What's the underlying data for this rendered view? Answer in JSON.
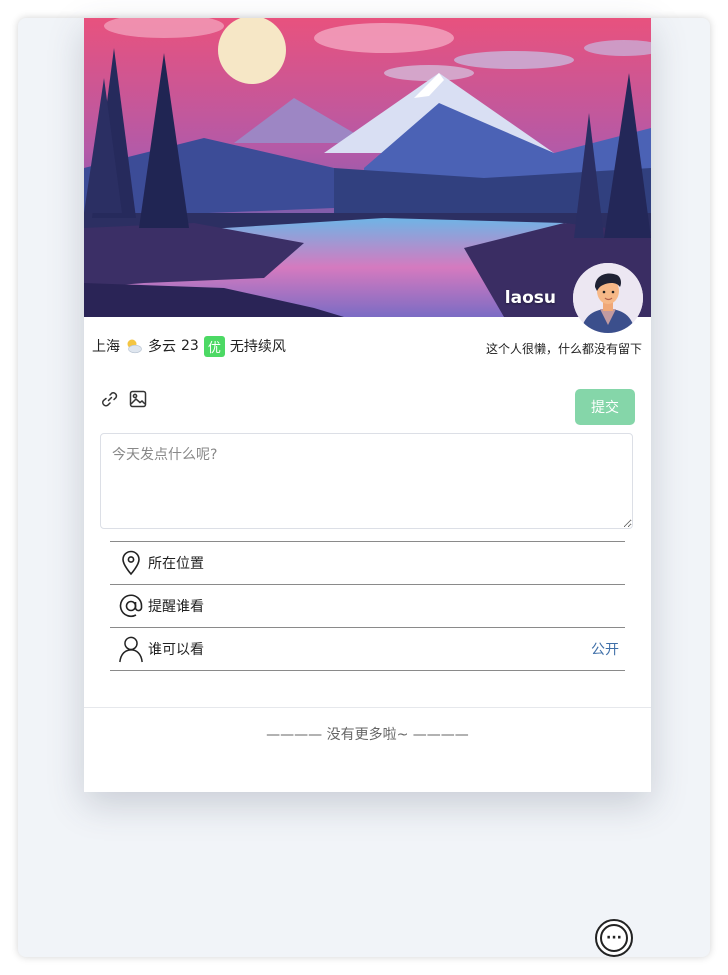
{
  "profile": {
    "username": "laosu",
    "signature": "这个人很懒，什么都没有留下",
    "cover_image": "mountain-lake-sunset-illustration",
    "avatar_image": "cartoon-man-avatar"
  },
  "weather": {
    "city": "上海",
    "icon": "partly-cloudy-icon",
    "condition": "多云",
    "temperature": "23",
    "aqi_label": "优",
    "wind": "无持续风",
    "aqi_color": "#4cd964"
  },
  "composer": {
    "link_icon": "link-icon",
    "image_icon": "image-icon",
    "submit_label": "提交",
    "submit_color": "#85d6a9",
    "placeholder": "今天发点什么呢?"
  },
  "options": [
    {
      "icon": "location-pin-icon",
      "label": "所在位置",
      "value": ""
    },
    {
      "icon": "at-sign-icon",
      "label": "提醒谁看",
      "value": ""
    },
    {
      "icon": "person-icon",
      "label": "谁可以看",
      "value": "公开"
    }
  ],
  "feed": {
    "end_text": "———— 没有更多啦~ ————"
  },
  "floating_button": {
    "icon": "more-dots-icon",
    "label": "···"
  }
}
